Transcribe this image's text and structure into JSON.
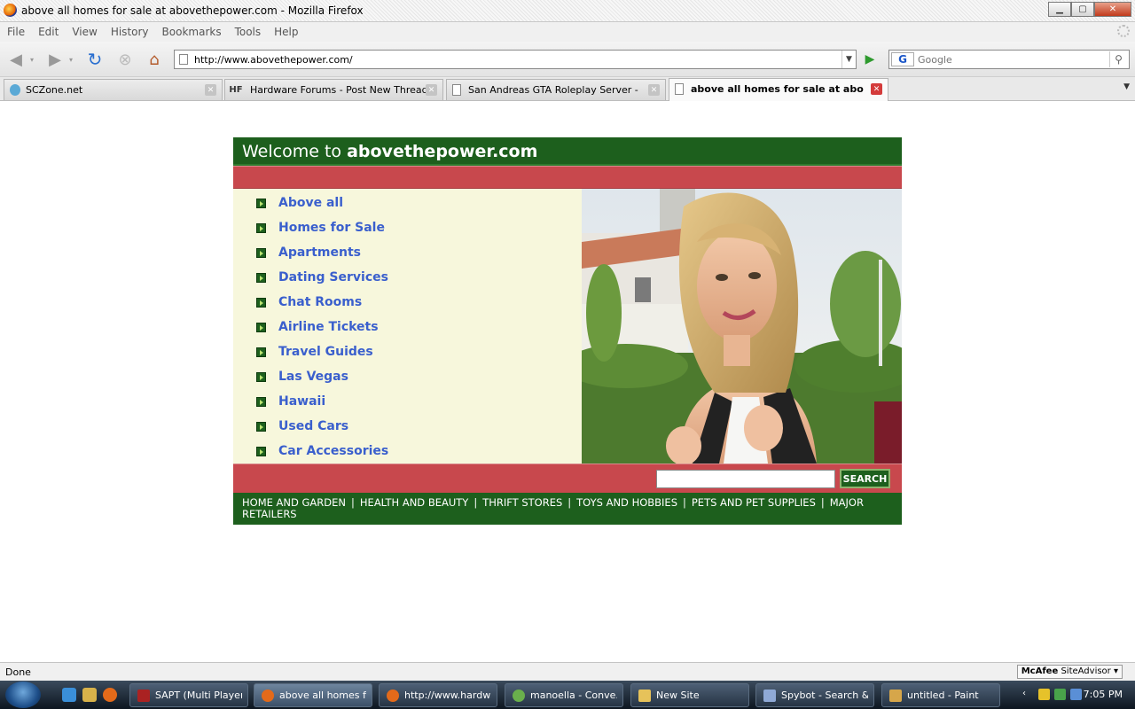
{
  "window": {
    "title": "above all homes for sale at abovethepower.com - Mozilla Firefox"
  },
  "menu": [
    "File",
    "Edit",
    "View",
    "History",
    "Bookmarks",
    "Tools",
    "Help"
  ],
  "navbar": {
    "url": "http://www.abovethepower.com/",
    "search_placeholder": "Google",
    "search_engine_glyph": "G"
  },
  "tabs": [
    {
      "label": "SCZone.net",
      "icon": "globe-icon"
    },
    {
      "label": "Hardware Forums - Post New Thread",
      "icon_text": "HF"
    },
    {
      "label": "San Andreas GTA Roleplay Server - Pow...",
      "icon": "page-icon"
    },
    {
      "label": "above all homes for sale at aboveth...",
      "icon": "page-icon",
      "active": true
    }
  ],
  "site": {
    "welcome": "Welcome to ",
    "domain": "abovethepower.com",
    "links": [
      "Above all",
      "Homes for Sale",
      "Apartments",
      "Dating Services",
      "Chat Rooms",
      "Airline Tickets",
      "Travel Guides",
      "Las Vegas",
      "Hawaii",
      "Used Cars",
      "Car Accessories"
    ],
    "search_button": "SEARCH",
    "categories": [
      "HOME AND GARDEN",
      "HEALTH AND BEAUTY",
      "THRIFT STORES",
      "TOYS AND HOBBIES",
      "PETS AND PET SUPPLIES",
      "MAJOR RETAILERS"
    ],
    "colors": {
      "green": "#1d5f1d",
      "red": "#c8484d",
      "cream": "#f7f7dc",
      "link": "#3a5fcd"
    }
  },
  "status": {
    "text": "Done",
    "siteadvisor_brand": "McAfee",
    "siteadvisor_label": "SiteAdvisor"
  },
  "taskbar": {
    "buttons": [
      {
        "label": "SAPT (Multi Player ..."
      },
      {
        "label": "above all homes fo...",
        "active": true
      },
      {
        "label": "http://www.hardwa..."
      },
      {
        "label": "manoella - Conve..."
      },
      {
        "label": "New Site"
      },
      {
        "label": "Spybot - Search & ..."
      },
      {
        "label": "untitled - Paint"
      }
    ],
    "clock": "7:05 PM"
  }
}
